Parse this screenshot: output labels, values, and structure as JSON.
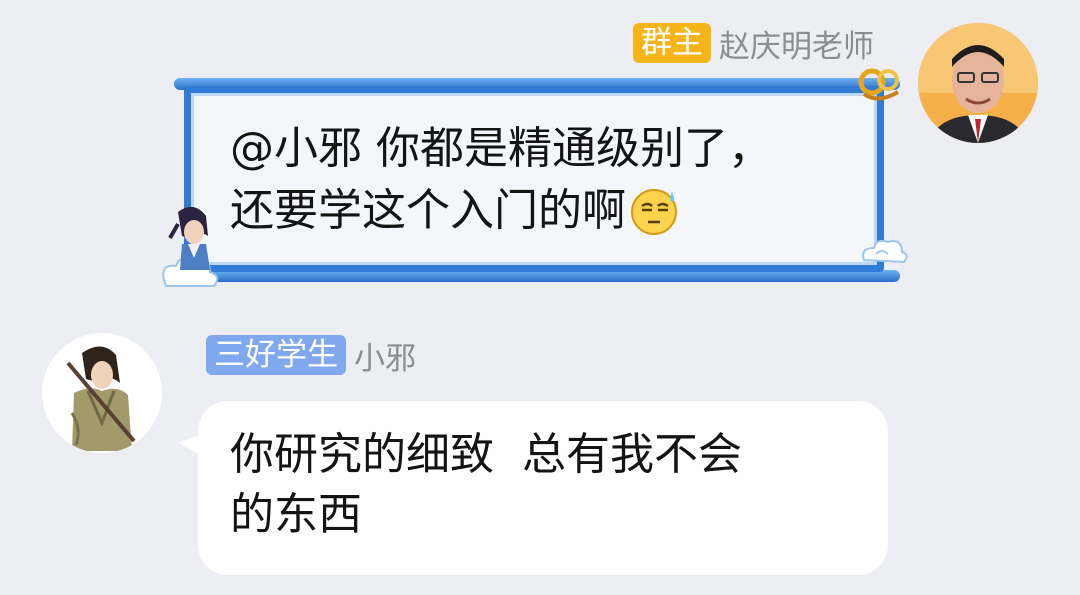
{
  "messages": [
    {
      "side": "right",
      "badge": "群主",
      "badge_color": "#f4b41a",
      "sender": "赵庆明老师",
      "bubble_style": "scroll",
      "text_line1": "@小邪 你都是精通级别了，",
      "text_line2": "还要学这个入门的啊",
      "emoji": "sweat-smile-emoji"
    },
    {
      "side": "left",
      "badge": "三好学生",
      "badge_color": "#7fa8ef",
      "sender": "小邪",
      "bubble_style": "plain",
      "text": "你研究的细致  总有我不会\n的东西"
    }
  ]
}
